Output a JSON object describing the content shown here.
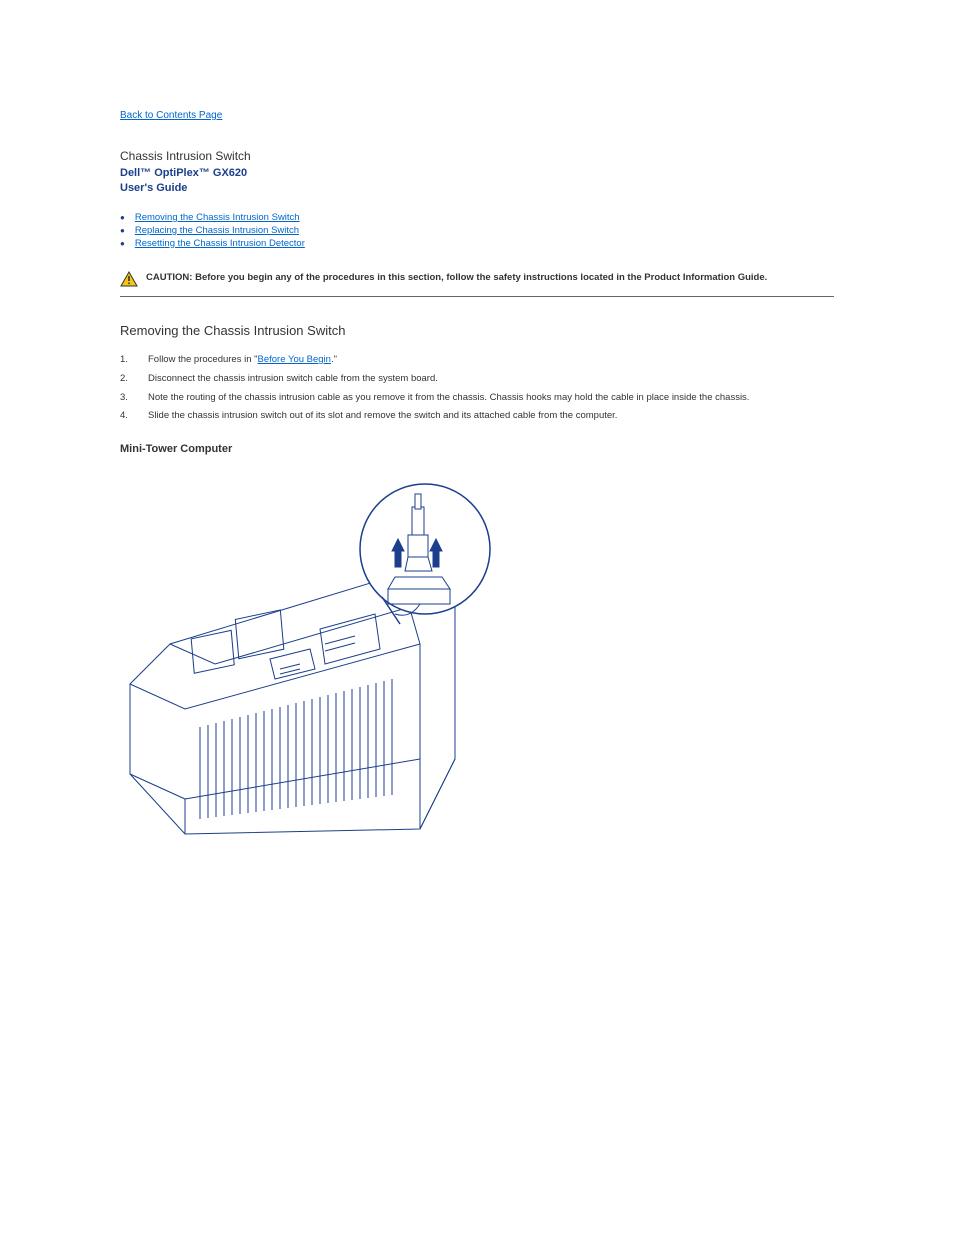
{
  "back": {
    "label": "Back to Contents Page"
  },
  "title": "Chassis Intrusion Switch",
  "subtitle_line1": "Dell™ OptiPlex™ GX620",
  "subtitle_line2": "User's Guide",
  "toc": [
    {
      "label": "Removing the Chassis Intrusion Switch"
    },
    {
      "label": "Replacing the Chassis Intrusion Switch"
    },
    {
      "label": "Resetting the Chassis Intrusion Detector"
    }
  ],
  "caution": {
    "prefix": "CAUTION:",
    "text": "Before you begin any of the procedures in this section, follow the safety instructions located in the Product Information Guide."
  },
  "section1": {
    "header": "Removing the Chassis Intrusion Switch",
    "steps": [
      {
        "num": "1.",
        "text_before": "Follow the procedures in \"",
        "link": "Before You Begin",
        "text_after": ".\""
      },
      {
        "num": "2.",
        "text": "Disconnect the chassis intrusion switch cable from the system board."
      },
      {
        "num": "3.",
        "text": "Note the routing of the chassis intrusion cable as you remove it from the chassis. Chassis hooks may hold the cable in place inside the chassis."
      },
      {
        "num": "4.",
        "text": "Slide the chassis intrusion switch out of its slot and remove the switch and its attached cable from the computer."
      }
    ],
    "subsection": "Mini-Tower Computer"
  }
}
